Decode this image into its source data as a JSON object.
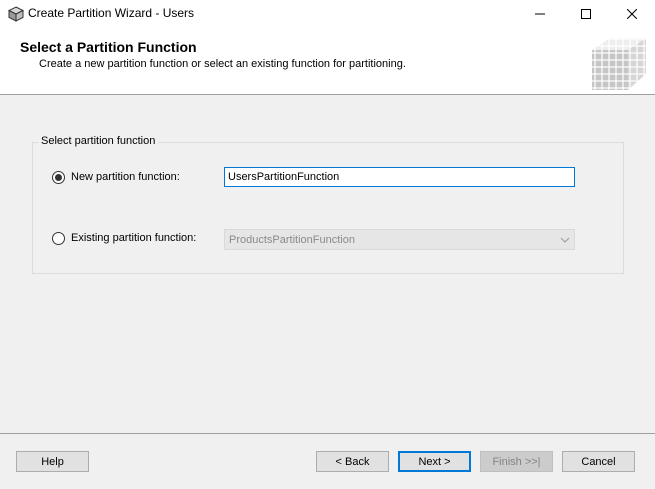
{
  "window": {
    "title": "Create Partition Wizard - Users",
    "app_icon": "database-cube-icon",
    "controls": [
      "minimize-icon",
      "maximize-icon",
      "close-icon"
    ]
  },
  "header": {
    "title": "Select a Partition Function",
    "subtitle": "Create a new partition function or select an existing function for partitioning.",
    "graphic": "cube-graphic"
  },
  "group": {
    "legend": "Select partition function",
    "new_option": {
      "label": "New partition function:",
      "selected": true,
      "value": "UsersPartitionFunction"
    },
    "existing_option": {
      "label": "Existing partition function:",
      "selected": false,
      "value": "ProductsPartitionFunction",
      "enabled": false
    }
  },
  "footer": {
    "help": "Help",
    "back": "< Back",
    "next": "Next >",
    "finish": "Finish >>|",
    "cancel": "Cancel"
  },
  "colors": {
    "accent": "#0078d7",
    "background": "#f0f0f0",
    "header_background": "#ffffff"
  }
}
